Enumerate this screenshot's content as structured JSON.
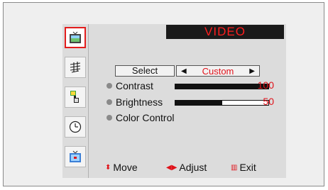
{
  "menu": {
    "title": "VIDEO",
    "icons": [
      {
        "name": "tv-picture-icon",
        "selected": true
      },
      {
        "name": "music-note-icon",
        "selected": false
      },
      {
        "name": "channel-setup-icon",
        "selected": false
      },
      {
        "name": "clock-icon",
        "selected": false
      },
      {
        "name": "tv-setup-icon",
        "selected": false
      }
    ]
  },
  "select": {
    "label": "Select",
    "value": "Custom",
    "left_arrow": "◀",
    "right_arrow": "▶"
  },
  "settings": [
    {
      "label": "Contrast",
      "value": "100",
      "level": 1.0
    },
    {
      "label": "Brightness",
      "value": "50",
      "level": 0.5
    },
    {
      "label": "Color Control"
    }
  ],
  "footer": {
    "move_glyph": "⬍",
    "move": "Move",
    "adjust_glyph": "◀▶",
    "adjust": "Adjust",
    "exit_glyph": "▥",
    "exit": "Exit"
  },
  "colors": {
    "accent": "#e0121a",
    "title_bg": "#1a1a1a"
  }
}
